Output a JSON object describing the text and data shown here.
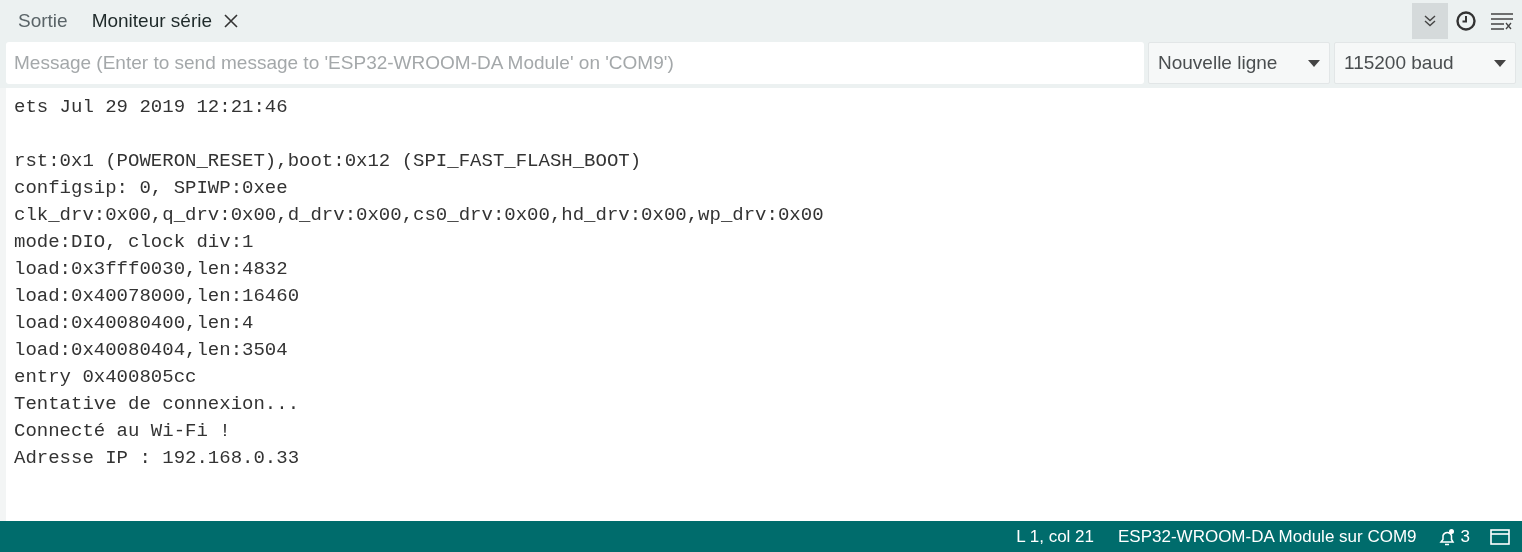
{
  "tabs": [
    {
      "label": "Sortie",
      "selected": false,
      "closable": false
    },
    {
      "label": "Moniteur série",
      "selected": true,
      "closable": true
    }
  ],
  "toolbar": {
    "autoscroll_on": true
  },
  "message": {
    "placeholder": "Message (Enter to send message to 'ESP32-WROOM-DA Module' on 'COM9')"
  },
  "line_ending": {
    "value": "Nouvelle ligne"
  },
  "baud_rate": {
    "value": "115200 baud"
  },
  "output_blocks": [
    [
      "ets Jul 29 2019 12:21:46"
    ],
    [
      "rst:0x1 (POWERON_RESET),boot:0x12 (SPI_FAST_FLASH_BOOT)",
      "configsip: 0, SPIWP:0xee",
      "clk_drv:0x00,q_drv:0x00,d_drv:0x00,cs0_drv:0x00,hd_drv:0x00,wp_drv:0x00",
      "mode:DIO, clock div:1",
      "load:0x3fff0030,len:4832",
      "load:0x40078000,len:16460",
      "load:0x40080400,len:4",
      "load:0x40080404,len:3504",
      "entry 0x400805cc",
      "Tentative de connexion...",
      "Connecté au Wi-Fi !",
      "Adresse IP : 192.168.0.33"
    ]
  ],
  "status_bar": {
    "position": "L 1, col 21",
    "board": "ESP32-WROOM-DA Module sur COM9",
    "notifications": "3"
  }
}
